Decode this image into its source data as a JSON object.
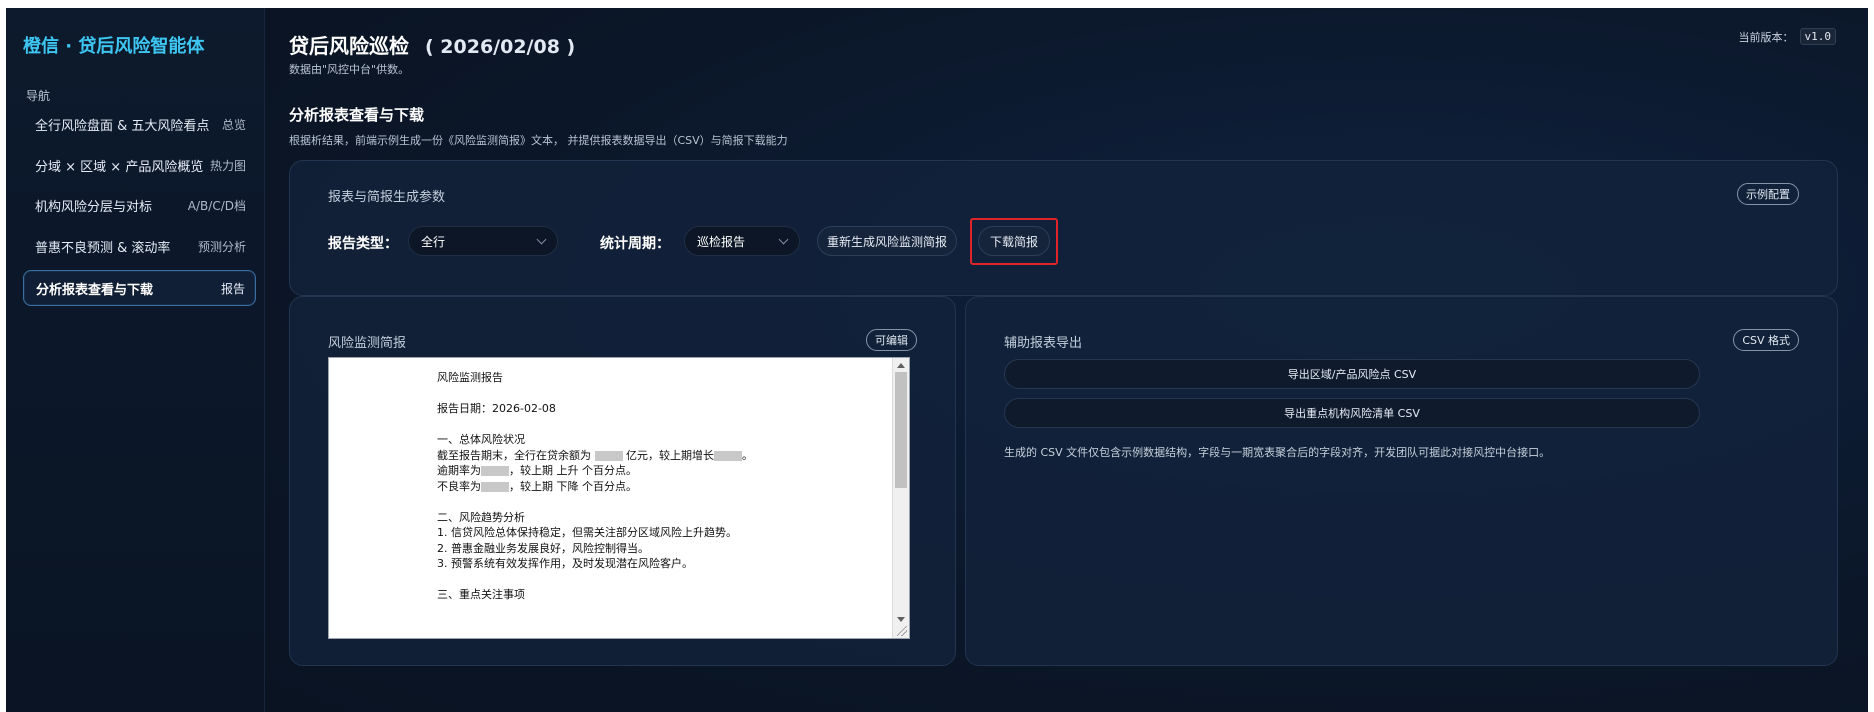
{
  "sidebar": {
    "brand": "橙信 · 贷后风险智能体",
    "nav_heading": "导航",
    "items": [
      {
        "label": "全行风险盘面 & 五大风险看点",
        "tag": "总览"
      },
      {
        "label": "分域 × 区域 × 产品风险概览",
        "tag": "热力图"
      },
      {
        "label": "机构风险分层与对标",
        "tag": "A/B/C/D档"
      },
      {
        "label": "普惠不良预测 & 滚动率",
        "tag": "预测分析"
      },
      {
        "label": "分析报表查看与下载",
        "tag": "报告"
      }
    ]
  },
  "header": {
    "title": "贷后风险巡检",
    "date": "( 2026/02/08 )",
    "subtitle": "数据由\"风控中台\"供数。",
    "version_label": "当前版本：",
    "version": "v1.0"
  },
  "section": {
    "title": "分析报表查看与下载",
    "description": "根据析结果，前端示例生成一份《风险监测简报》文本， 并提供报表数据导出（CSV）与简报下载能力"
  },
  "params": {
    "card_title": "报表与简报生成参数",
    "config_badge": "示例配置",
    "report_type_label": "报告类型：",
    "report_type_value": "全行",
    "period_label": "统计周期：",
    "period_value": "巡检报告",
    "regenerate_button": "重新生成风险监测简报",
    "download_button": "下载简报"
  },
  "brief": {
    "card_title": "风险监测简报",
    "editable_badge": "可编辑",
    "lines": [
      "风险监测报告",
      "",
      "报告日期：2026-02-08",
      "",
      "一、总体风险状况",
      "截至报告期末，全行在贷余额为 ▒▒ 亿元，较上期增长▒▒。",
      "逾期率为▒▒，较上期 上升 个百分点。",
      "不良率为▒▒，较上期 下降 个百分点。",
      "",
      "二、风险趋势分析",
      "1. 信贷风险总体保持稳定，但需关注部分区域风险上升趋势。",
      "2. 普惠金融业务发展良好，风险控制得当。",
      "3. 预警系统有效发挥作用，及时发现潜在风险客户。",
      "",
      "三、重点关注事项"
    ]
  },
  "export": {
    "card_title": "辅助报表导出",
    "format_badge": "CSV 格式",
    "region_button": "导出区域/产品风险点 CSV",
    "institution_button": "导出重点机构风险清单 CSV",
    "note": "生成的 CSV 文件仅包含示例数据结构，字段与一期宽表聚合后的字段对齐，开发团队可据此对接风控中台接口。"
  },
  "colors": {
    "brand": "#3ec6f2",
    "background": "#0b1424",
    "highlight": "#e0242a"
  }
}
